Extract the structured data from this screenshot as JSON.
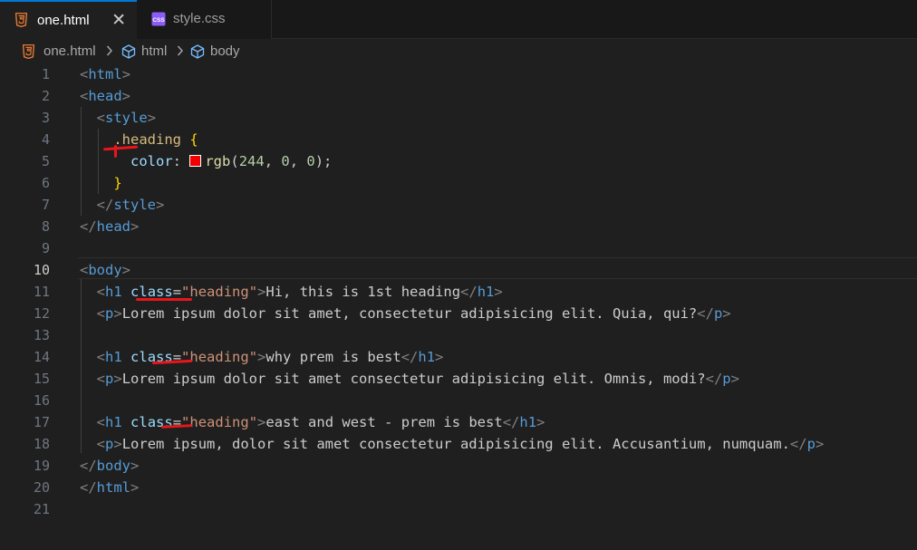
{
  "tabs": [
    {
      "label": "one.html",
      "active": true,
      "icon": "html5-icon",
      "close": "✕"
    },
    {
      "label": "style.css",
      "active": false,
      "icon": "css-icon"
    }
  ],
  "breadcrumb": {
    "file": "one.html",
    "items": [
      "html",
      "body"
    ]
  },
  "current_line": 10,
  "lines": [
    {
      "n": "1"
    },
    {
      "n": "2"
    },
    {
      "n": "3"
    },
    {
      "n": "4"
    },
    {
      "n": "5"
    },
    {
      "n": "6"
    },
    {
      "n": "7"
    },
    {
      "n": "8"
    },
    {
      "n": "9"
    },
    {
      "n": "10"
    },
    {
      "n": "11"
    },
    {
      "n": "12"
    },
    {
      "n": "13"
    },
    {
      "n": "14"
    },
    {
      "n": "15"
    },
    {
      "n": "16"
    },
    {
      "n": "17"
    },
    {
      "n": "18"
    },
    {
      "n": "19"
    },
    {
      "n": "20"
    },
    {
      "n": "21"
    }
  ],
  "code": {
    "l1": {
      "tag": "html"
    },
    "l2": {
      "tag": "head"
    },
    "l3": {
      "tag": "style"
    },
    "l4": {
      "selector": ".heading",
      "brace": "{"
    },
    "l5": {
      "prop": "color",
      "fn": "rgb",
      "args": [
        "244",
        "0",
        "0"
      ],
      "color_hex": "#f40000"
    },
    "l6": {
      "brace": "}"
    },
    "l7": {
      "tag": "style"
    },
    "l8": {
      "tag": "head"
    },
    "l10": {
      "tag": "body"
    },
    "l11": {
      "tag": "h1",
      "attr": "class",
      "value": "\"heading\"",
      "text": "Hi, this is 1st heading"
    },
    "l12": {
      "tag": "p",
      "text": "Lorem ipsum dolor sit amet, consectetur adipisicing elit. Quia, qui?"
    },
    "l14": {
      "tag": "h1",
      "attr": "class",
      "value": "\"heading\"",
      "text": "why prem is best"
    },
    "l15": {
      "tag": "p",
      "text": "Lorem ipsum dolor sit amet consectetur adipisicing elit. Omnis, modi?"
    },
    "l17": {
      "tag": "h1",
      "attr": "class",
      "value": "\"heading\"",
      "text": "east and west - prem is best"
    },
    "l18": {
      "tag": "p",
      "text": "Lorem ipsum, dolor sit amet consectetur adipisicing elit. Accusantium, numquam."
    },
    "l19": {
      "tag": "body"
    },
    "l20": {
      "tag": "html"
    }
  },
  "colors": {
    "accent": "#0078d4",
    "annotation": "#e8161b",
    "swatch": "#f40000"
  }
}
